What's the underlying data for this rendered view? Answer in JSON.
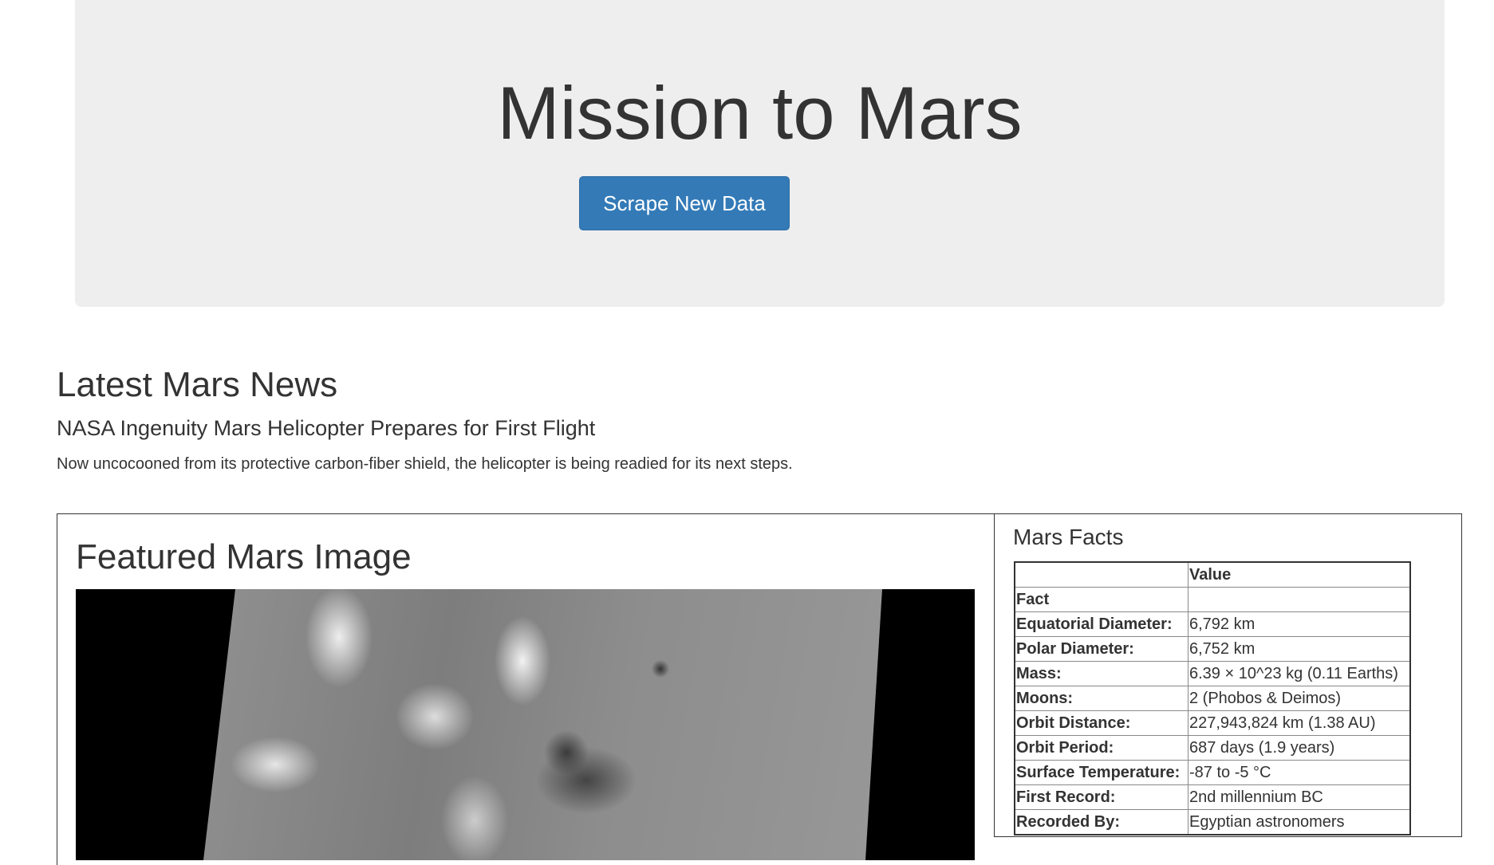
{
  "jumbotron": {
    "title": "Mission to Mars",
    "button_label": "Scrape New Data",
    "button_color": "#337ab7",
    "background": "#eeeeee"
  },
  "news": {
    "section_title": "Latest Mars News",
    "headline": "NASA Ingenuity Mars Helicopter Prepares for First Flight",
    "teaser": "Now uncocooned from its protective carbon-fiber shield, the helicopter is being readied for its next steps."
  },
  "featured": {
    "title": "Featured Mars Image"
  },
  "facts": {
    "title": "Mars Facts",
    "header": [
      "",
      "Value"
    ],
    "index_label": "Fact",
    "rows": [
      {
        "fact": "Equatorial Diameter:",
        "value": "6,792 km"
      },
      {
        "fact": "Polar Diameter:",
        "value": "6,752 km"
      },
      {
        "fact": "Mass:",
        "value": "6.39 × 10^23 kg (0.11 Earths)"
      },
      {
        "fact": "Moons:",
        "value": "2 (Phobos & Deimos)"
      },
      {
        "fact": "Orbit Distance:",
        "value": "227,943,824 km (1.38 AU)"
      },
      {
        "fact": "Orbit Period:",
        "value": "687 days (1.9 years)"
      },
      {
        "fact": "Surface Temperature:",
        "value": "-87 to -5 °C"
      },
      {
        "fact": "First Record:",
        "value": "2nd millennium BC"
      },
      {
        "fact": "Recorded By:",
        "value": "Egyptian astronomers"
      }
    ]
  }
}
